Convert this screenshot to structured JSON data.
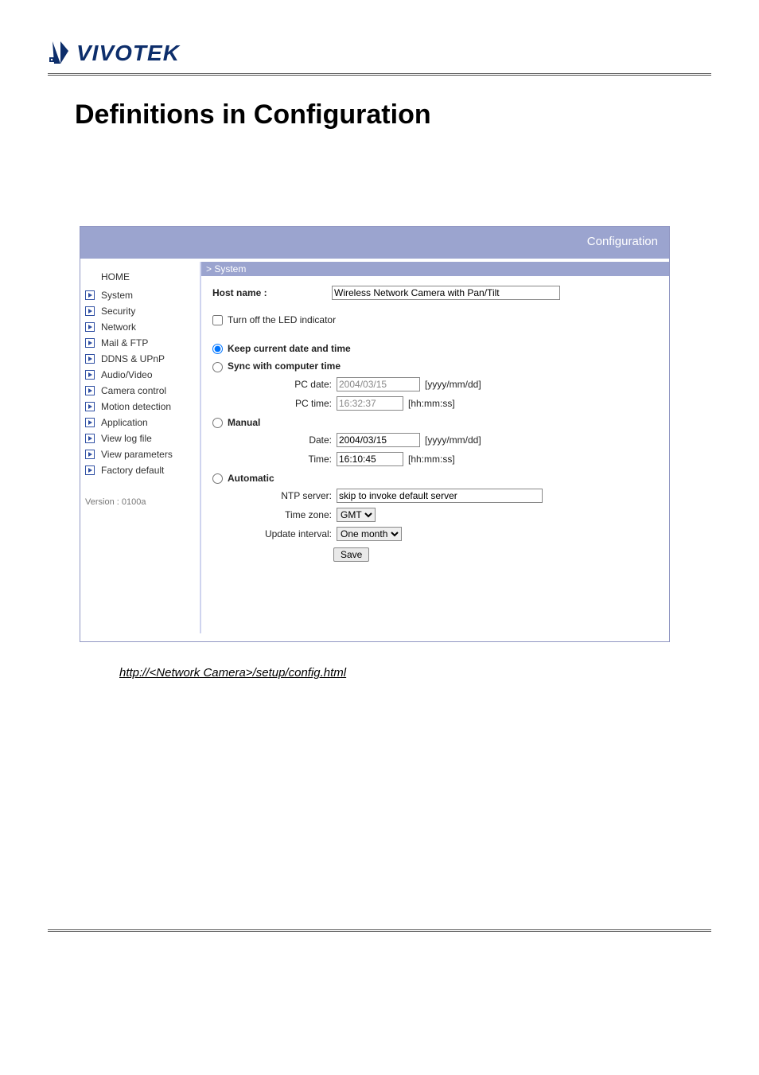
{
  "brand": "VIVOTEK",
  "page_title": "Definitions in Configuration",
  "titlebar": "Configuration",
  "sidebar": {
    "home": "HOME",
    "items": [
      {
        "label": "System"
      },
      {
        "label": "Security"
      },
      {
        "label": "Network"
      },
      {
        "label": "Mail & FTP"
      },
      {
        "label": "DDNS & UPnP"
      },
      {
        "label": "Audio/Video"
      },
      {
        "label": "Camera control"
      },
      {
        "label": "Motion detection"
      },
      {
        "label": "Application"
      },
      {
        "label": "View log file"
      },
      {
        "label": "View parameters"
      },
      {
        "label": "Factory default"
      }
    ],
    "version": "Version : 0100a"
  },
  "main": {
    "crumb": "> System",
    "hostname_label": "Host name :",
    "hostname_value": "Wireless Network Camera with Pan/Tilt",
    "led_label": "Turn off the LED indicator",
    "opt_keep": "Keep current date and time",
    "opt_sync": "Sync with computer time",
    "pcdate_label": "PC date:",
    "pcdate_value": "2004/03/15",
    "pcdate_hint": "[yyyy/mm/dd]",
    "pctime_label": "PC time:",
    "pctime_value": "16:32:37",
    "pctime_hint": "[hh:mm:ss]",
    "opt_manual": "Manual",
    "date_label": "Date:",
    "date_value": "2004/03/15",
    "date_hint": "[yyyy/mm/dd]",
    "time_label": "Time:",
    "time_value": "16:10:45",
    "time_hint": "[hh:mm:ss]",
    "opt_auto": "Automatic",
    "ntp_label": "NTP server:",
    "ntp_value": "skip to invoke default server",
    "tz_label": "Time zone:",
    "tz_value": "GMT",
    "upd_label": "Update interval:",
    "upd_value": "One month",
    "save": "Save"
  },
  "footer_url": "http://<Network Camera>/setup/config.html"
}
